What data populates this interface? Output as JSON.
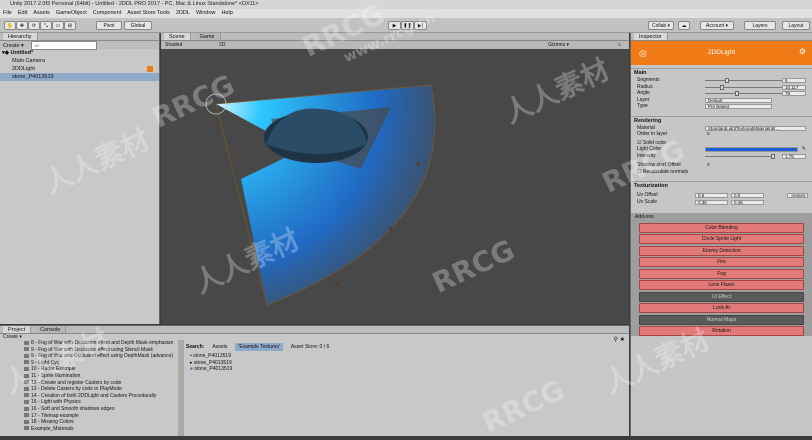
{
  "window": {
    "title": "Unity 2017.2.0f3 Personal (64bit) - Untitled - 2DDL PRO 2017 - PC, Mac & Linux Standalone* <DX11>"
  },
  "menu": [
    "File",
    "Edit",
    "Assets",
    "GameObject",
    "Component",
    "Asset Store Tools",
    "2DDL",
    "Window",
    "Help"
  ],
  "toolbar": {
    "pivot": "Pivot",
    "global": "Global",
    "collab": "Collab ▾",
    "account": "Account ▾",
    "layers": "Layers",
    "layout": "Layout"
  },
  "hierarchy": {
    "tab": "Hierarchy",
    "create": "Create ▾",
    "search_placeholder": "All",
    "scene_name": "Untitled*",
    "items": [
      "Main Camera",
      "2DDLight",
      "stone_P4013519"
    ]
  },
  "scene": {
    "tab_scene": "Scene",
    "tab_game": "Game",
    "shading": "Shaded",
    "mode": "2D",
    "gizmos": "Gizmos ▾"
  },
  "inspector": {
    "tab": "Inspector",
    "object_name": "2DDLight",
    "main": {
      "title": "Main",
      "segments_label": "Segments",
      "segments_value": "5",
      "radius_label": "Radius",
      "radius_value": "10.117",
      "angle_label": "Angle",
      "angle_value": "78",
      "layer_label": "Layer",
      "layer_value": "Default",
      "type_label": "Type",
      "type_value": "Pre Baked"
    },
    "rendering": {
      "title": "Rendering",
      "material_label": "Material",
      "material_value": "StandardLightTexturedMaterial(dlr...",
      "order_label": "Order in layer",
      "order_value": "0",
      "solid_color": "Solid color",
      "light_color_label": "Light Color",
      "intensity_label": "Intensity",
      "intensity_value": "1.75",
      "shadow_offset_label": "Shadow start Offset",
      "shadow_offset_value": "0",
      "recalc_normals": "Recalculate normals"
    },
    "uv": {
      "title": "Texturization",
      "offset_label": "Uv Offset",
      "offset_x": "0.5",
      "offset_y": "0.5",
      "scale_label": "Uv Scale",
      "scale_x": "0.36",
      "scale_y": "0.36",
      "restore": "restore"
    },
    "addons": {
      "title": "Add-ons",
      "buttons": [
        "Color Blending",
        "Circle Sprite Light",
        "Enemy Detection",
        "Fire",
        "Fog",
        "Lens Flares",
        "UI Effect",
        "Look At",
        "Normal Maps",
        "Rotation"
      ]
    }
  },
  "project": {
    "tab_project": "Project",
    "tab_console": "Console",
    "create": "Create ▾",
    "tree": [
      "8 - Fog of War with Occlusion effect and Depth Mask emphasize",
      "9 - Fog of War with Occlusion effect using Stencil Mask",
      "9 - Fog of War and Occlusion effect using DepthMask (advance)",
      "9 - Light Cyc",
      "10 - Radar Example",
      "11 - Sprite Illumination",
      "12 - Create and register Casters by code",
      "13 - Delete Casters by code in PlayMode",
      "14 - Creation of both 2DDLight and Casters Procedurally",
      "15 - Light with Physics",
      "16 - Soft and Smooth shadows edges",
      "17 - Tilemap example",
      "18 - Missing Colors",
      "Example_Materials"
    ],
    "search_label": "Search:",
    "search_tabs": [
      "Assets",
      "'Example Textures'",
      "Asset Store: 0 / 6"
    ],
    "results": [
      "stone_P4013519",
      "stone_P4013519",
      "stone_P4013519"
    ]
  },
  "watermarks": [
    "RRCG",
    "人人素材",
    "RRCG",
    "人人素材",
    "RRCG",
    "人人素材",
    "RRCG",
    "人人素材",
    "人人素材",
    "RRCG",
    "www.rrcg.cn"
  ],
  "colors": {
    "accent": "#f07b16",
    "addon_button": "#e27a7a",
    "light_blue": "#1a5bd6",
    "selection": "#8fa9c9"
  }
}
